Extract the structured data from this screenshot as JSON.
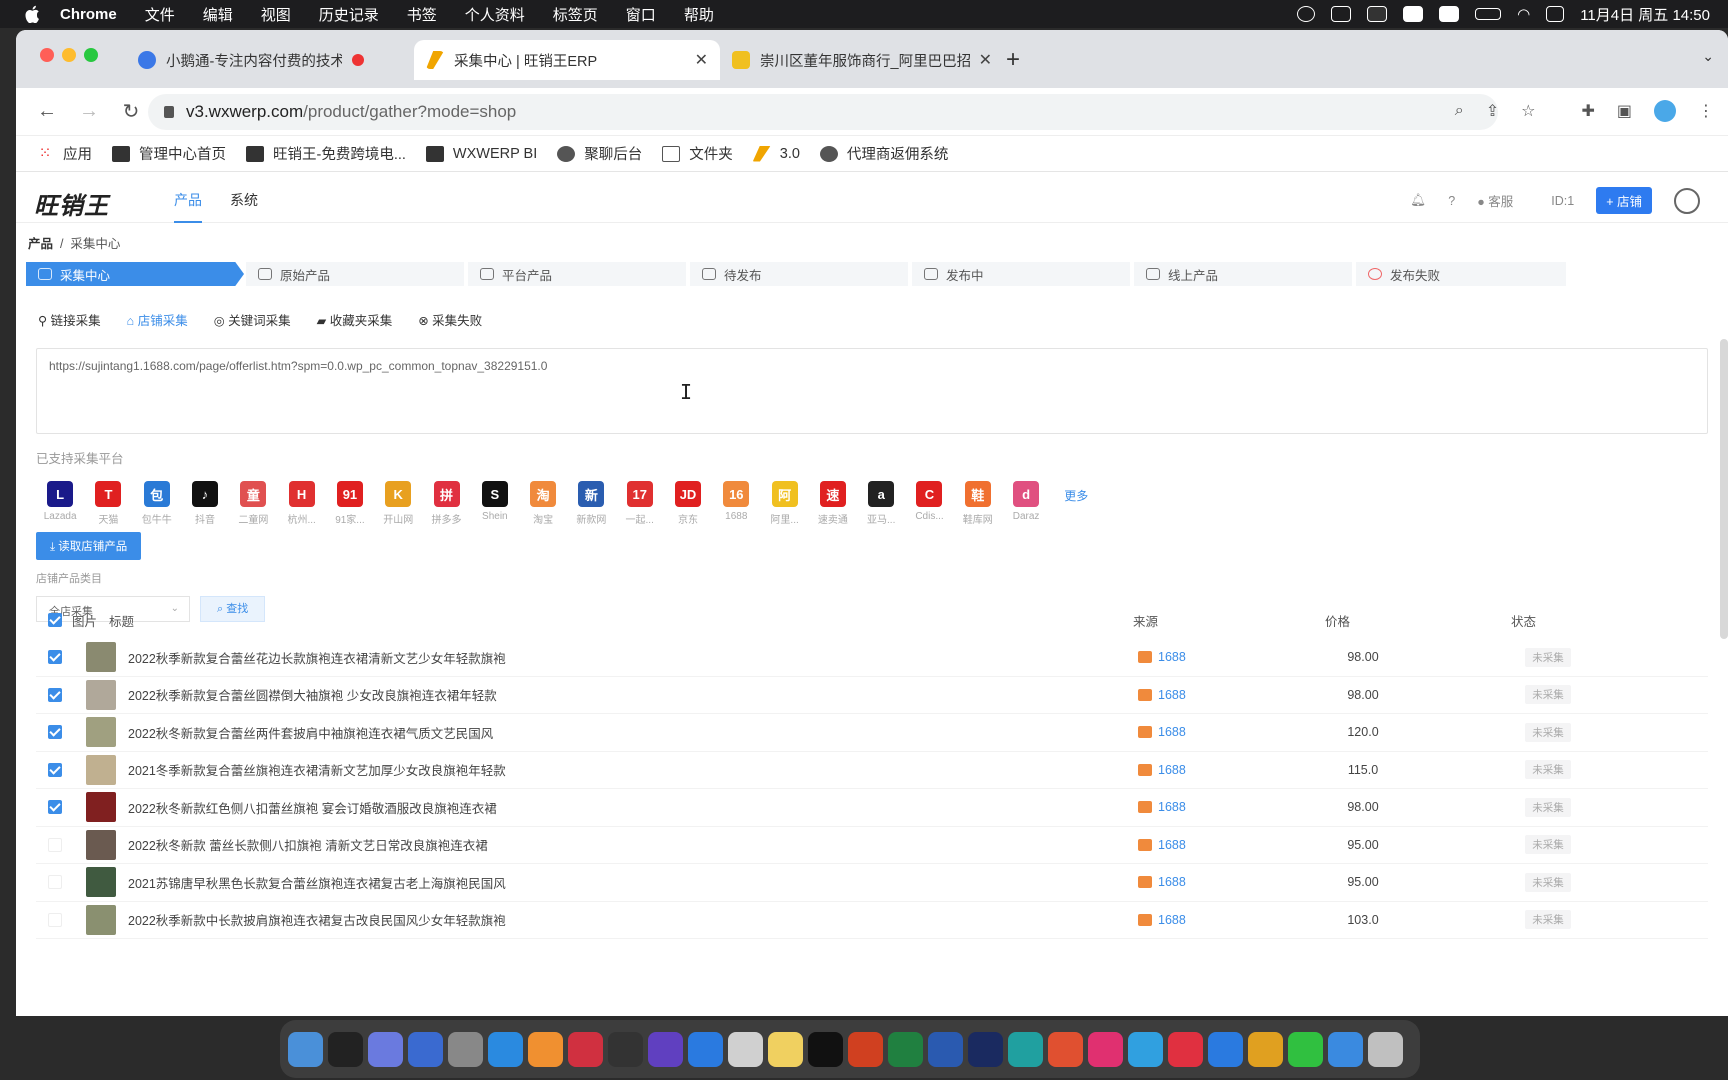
{
  "menubar": {
    "items": [
      "Chrome",
      "文件",
      "编辑",
      "视图",
      "历史记录",
      "书签",
      "个人资料",
      "标签页",
      "窗口",
      "帮助"
    ],
    "datetime": "11月4日 周五  14:50"
  },
  "tabs": [
    {
      "title": "小鹅通-专注内容付费的技术",
      "fav_color": "#3b78e7"
    },
    {
      "title": "采集中心 | 旺销王ERP",
      "fav_color": "#f0a500"
    },
    {
      "title": "崇川区董年服饰商行_阿里巴巴招",
      "fav_color": "#e33"
    }
  ],
  "address": {
    "host": "v3.wxwerp.com",
    "path": "/product/gather?mode=shop"
  },
  "bookmarks": [
    {
      "label": "应用",
      "icon": "grid"
    },
    {
      "label": "管理中心首页",
      "icon": "site"
    },
    {
      "label": "旺销王-免费跨境电...",
      "icon": "site"
    },
    {
      "label": "WXWERP BI",
      "icon": "site"
    },
    {
      "label": "聚聊后台",
      "icon": "globe"
    },
    {
      "label": "文件夹",
      "icon": "folder"
    },
    {
      "label": "3.0",
      "icon": "pen"
    },
    {
      "label": "代理商返佣系统",
      "icon": "globe"
    }
  ],
  "app": {
    "logo": "旺销王",
    "nav": [
      "产品",
      "系统"
    ],
    "header_right": {
      "service": "客服",
      "id": "ID:1",
      "shop_btn": "+ 店铺"
    },
    "breadcrumb": [
      "产品",
      "采集中心"
    ],
    "steps": [
      "采集中心",
      "原始产品",
      "平台产品",
      "待发布",
      "发布中",
      "线上产品",
      "发布失败"
    ],
    "subtabs": [
      "链接采集",
      "店铺采集",
      "关键词采集",
      "收藏夹采集",
      "采集失败"
    ],
    "url_value": "https://sujintang1.1688.com/page/offerlist.htm?spm=0.0.wp_pc_common_topnav_38229151.0",
    "supported_label": "已支持采集平台",
    "platforms": [
      {
        "name": "Lazada",
        "mark": "L",
        "color": "#1a1a8a"
      },
      {
        "name": "天猫",
        "mark": "T",
        "color": "#e02020"
      },
      {
        "name": "包牛牛",
        "mark": "包",
        "color": "#2a7ad6"
      },
      {
        "name": "抖音",
        "mark": "♪",
        "color": "#111"
      },
      {
        "name": "二童网",
        "mark": "童",
        "color": "#e05050"
      },
      {
        "name": "杭州...",
        "mark": "H",
        "color": "#e03030"
      },
      {
        "name": "91家...",
        "mark": "91",
        "color": "#e02020"
      },
      {
        "name": "开山网",
        "mark": "K",
        "color": "#e8a020"
      },
      {
        "name": "拼多多",
        "mark": "拼",
        "color": "#e03040"
      },
      {
        "name": "Shein",
        "mark": "S",
        "color": "#111"
      },
      {
        "name": "淘宝",
        "mark": "淘",
        "color": "#f08a3c"
      },
      {
        "name": "新款网",
        "mark": "新",
        "color": "#2a5db0"
      },
      {
        "name": "一起...",
        "mark": "17",
        "color": "#e03030"
      },
      {
        "name": "京东",
        "mark": "JD",
        "color": "#e02020"
      },
      {
        "name": "1688",
        "mark": "16",
        "color": "#f08a3c"
      },
      {
        "name": "阿里...",
        "mark": "阿",
        "color": "#f0c020"
      },
      {
        "name": "速卖通",
        "mark": "速",
        "color": "#e02020"
      },
      {
        "name": "亚马...",
        "mark": "a",
        "color": "#222"
      },
      {
        "name": "Cdis...",
        "mark": "C",
        "color": "#e02020"
      },
      {
        "name": "鞋库网",
        "mark": "鞋",
        "color": "#f07030"
      },
      {
        "name": "Daraz",
        "mark": "d",
        "color": "#e05080"
      }
    ],
    "more": "更多",
    "get_btn": "读取店铺产品",
    "category_label": "店铺产品类目",
    "category_value": "全店采集",
    "find_btn": "查找",
    "table": {
      "headers": {
        "image": "图片",
        "title": "标题",
        "source": "来源",
        "price": "价格",
        "status": "状态"
      },
      "rows": [
        {
          "checked": true,
          "title": "2022秋季新款复合蕾丝花边长款旗袍连衣裙清新文艺少女年轻款旗袍",
          "source": "1688",
          "price": "98.00",
          "status": "未采集",
          "thumb": "#8a8a70"
        },
        {
          "checked": true,
          "title": "2022秋季新款复合蕾丝圆襟倒大袖旗袍 少女改良旗袍连衣裙年轻款",
          "source": "1688",
          "price": "98.00",
          "status": "未采集",
          "thumb": "#b0a89a"
        },
        {
          "checked": true,
          "title": "2022秋冬新款复合蕾丝两件套披肩中袖旗袍连衣裙气质文艺民国风",
          "source": "1688",
          "price": "120.0",
          "status": "未采集",
          "thumb": "#a0a080"
        },
        {
          "checked": true,
          "title": "2021冬季新款复合蕾丝旗袍连衣裙清新文艺加厚少女改良旗袍年轻款",
          "source": "1688",
          "price": "115.0",
          "status": "未采集",
          "thumb": "#c0b090"
        },
        {
          "checked": true,
          "title": "2022秋冬新款红色侧八扣蕾丝旗袍 宴会订婚敬酒服改良旗袍连衣裙",
          "source": "1688",
          "price": "98.00",
          "status": "未采集",
          "thumb": "#802020"
        },
        {
          "checked": false,
          "title": "2022秋冬新款 蕾丝长款侧八扣旗袍 清新文艺日常改良旗袍连衣裙",
          "source": "1688",
          "price": "95.00",
          "status": "未采集",
          "thumb": "#6a5a50"
        },
        {
          "checked": false,
          "title": "2021苏锦唐早秋黑色长款复合蕾丝旗袍连衣裙复古老上海旗袍民国风",
          "source": "1688",
          "price": "95.00",
          "status": "未采集",
          "thumb": "#405a40"
        },
        {
          "checked": false,
          "title": "2022秋季新款中长款披肩旗袍连衣裙复古改良民国风少女年轻款旗袍",
          "source": "1688",
          "price": "103.0",
          "status": "未采集",
          "thumb": "#8a9070"
        }
      ]
    }
  },
  "dock_colors": [
    "#4a90d9",
    "#222",
    "#6a7adf",
    "#3a6ad0",
    "#888",
    "#2a8ae0",
    "#f09030",
    "#d03040",
    "#333",
    "#6040c0",
    "#2a7ae0",
    "#d0d0d0",
    "#f0d060",
    "#111",
    "#d04020",
    "#208040",
    "#2a5ab0",
    "#1a2a60",
    "#20a0a0",
    "#e05030",
    "#e03070",
    "#30a0e0",
    "#e03040",
    "#2a7ae0",
    "#e0a020",
    "#30c040",
    "#3a8ae0",
    "#c0c0c0"
  ]
}
